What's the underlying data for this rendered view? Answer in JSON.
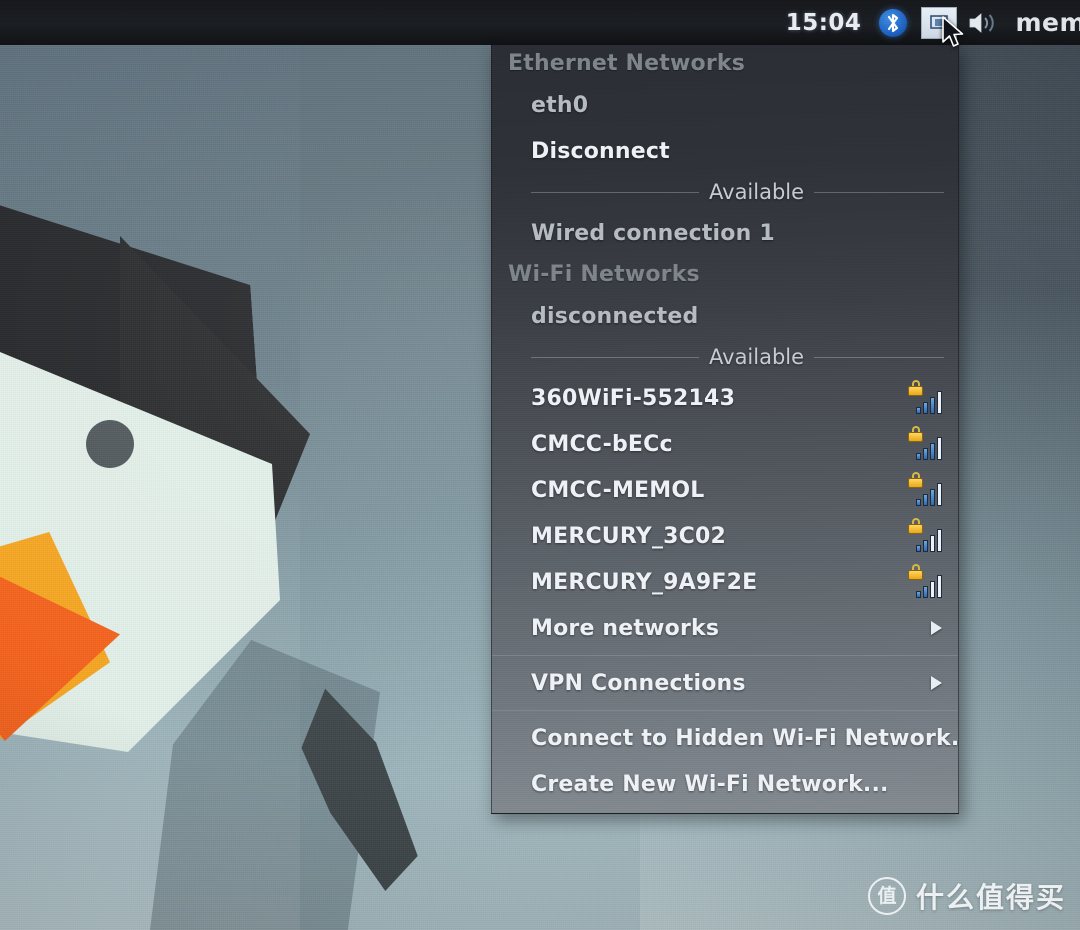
{
  "taskbar": {
    "clock": "15:04",
    "bluetooth_icon": "bluetooth-icon",
    "bluetooth_glyph": "ᛦ",
    "network_icon": "network-tray-icon",
    "network_glyph": "▤",
    "volume_icon": "volume-icon",
    "app_text": "mem"
  },
  "menu": {
    "ethernet": {
      "section_title": "Ethernet Networks",
      "device": "eth0",
      "action": "Disconnect",
      "separator": "Available",
      "connections": [
        {
          "label": "Wired connection 1"
        }
      ]
    },
    "wifi": {
      "section_title": "Wi-Fi Networks",
      "status": "disconnected",
      "separator": "Available",
      "networks": [
        {
          "ssid": "360WiFi-552143",
          "secured": true,
          "signal": 3
        },
        {
          "ssid": "CMCC-bECc",
          "secured": true,
          "signal": 3
        },
        {
          "ssid": "CMCC-MEMOL",
          "secured": true,
          "signal": 3
        },
        {
          "ssid": "MERCURY_3C02",
          "secured": true,
          "signal": 2
        },
        {
          "ssid": "MERCURY_9A9F2E",
          "secured": true,
          "signal": 2
        }
      ],
      "more_networks": "More networks"
    },
    "vpn": {
      "label": "VPN Connections"
    },
    "actions": [
      {
        "label": "Connect to Hidden Wi-Fi Network..."
      },
      {
        "label": "Create New Wi-Fi Network..."
      }
    ]
  },
  "watermark": {
    "logo": "值",
    "text": "什么值得买"
  },
  "colors": {
    "panel_bg": "#1b1e22",
    "menu_top": "#2b2e34",
    "menu_bottom": "#848b91",
    "text_primary": "#eef2f6",
    "text_dim": "#b6bcc3",
    "section_title": "#7f858d",
    "bluetooth_blue": "#1f63c4",
    "lock_yellow": "#e8a81d",
    "signal_blue": "#2a6bb5"
  }
}
